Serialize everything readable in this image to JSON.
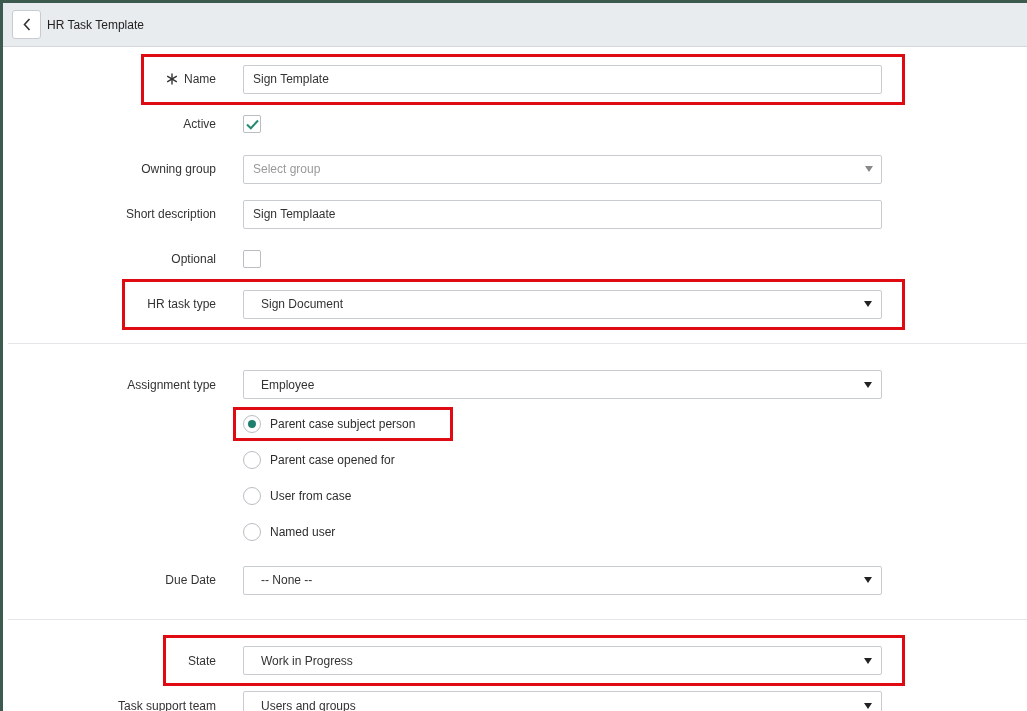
{
  "header": {
    "title": "HR Task Template"
  },
  "sections": [
    {
      "rows": [
        {
          "kind": "text",
          "label": "Name",
          "value": "Sign Template",
          "required": true,
          "highlighted": true
        },
        {
          "kind": "checkbox",
          "label": "Active",
          "checked": true,
          "highlighted": false
        },
        {
          "kind": "reference",
          "label": "Owning group",
          "placeholder": "Select group",
          "highlighted": false
        },
        {
          "kind": "text",
          "label": "Short description",
          "value": "Sign Templaate",
          "required": false,
          "highlighted": false
        },
        {
          "kind": "checkbox",
          "label": "Optional",
          "checked": false,
          "highlighted": false
        },
        {
          "kind": "select",
          "label": "HR task type",
          "value": "Sign Document",
          "highlighted": true
        }
      ]
    },
    {
      "rows": [
        {
          "kind": "select",
          "label": "Assignment type",
          "value": "Employee",
          "highlighted": false,
          "options": [
            {
              "label": "Parent case subject person",
              "selected": true,
              "highlighted": true
            },
            {
              "label": "Parent case opened for",
              "selected": false,
              "highlighted": false
            },
            {
              "label": "User from case",
              "selected": false,
              "highlighted": false
            },
            {
              "label": "Named user",
              "selected": false,
              "highlighted": false
            }
          ]
        },
        {
          "kind": "select",
          "label": "Due Date",
          "value": "-- None --",
          "highlighted": false
        }
      ]
    },
    {
      "rows": [
        {
          "kind": "select",
          "label": "State",
          "value": "Work in Progress",
          "highlighted": true
        },
        {
          "kind": "select",
          "label": "Task support team",
          "value": "Users and groups",
          "highlighted": false
        }
      ]
    }
  ]
}
